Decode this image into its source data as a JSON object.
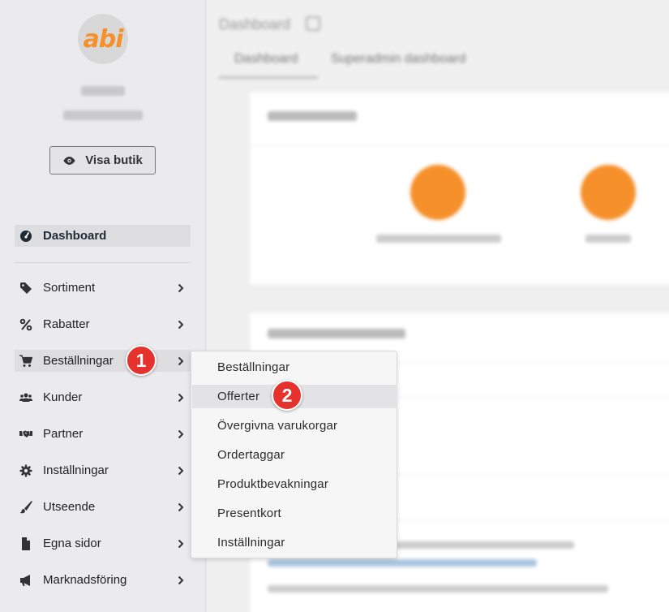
{
  "sidebar": {
    "logo_text": "abi",
    "visa_butik_label": "Visa butik",
    "dashboard_label": "Dashboard",
    "items": [
      {
        "label": "Sortiment",
        "icon": "tag-icon"
      },
      {
        "label": "Rabatter",
        "icon": "percent-icon"
      },
      {
        "label": "Beställningar",
        "icon": "cart-icon"
      },
      {
        "label": "Kunder",
        "icon": "users-icon"
      },
      {
        "label": "Partner",
        "icon": "handshake-icon"
      },
      {
        "label": "Inställningar",
        "icon": "gear-icon"
      },
      {
        "label": "Utseende",
        "icon": "brush-icon"
      },
      {
        "label": "Egna sidor",
        "icon": "file-icon"
      },
      {
        "label": "Marknadsföring",
        "icon": "megaphone-icon"
      }
    ]
  },
  "dropdown": {
    "items": [
      "Beställningar",
      "Offerter",
      "Övergivna varukorgar",
      "Ordertaggar",
      "Produktbevakningar",
      "Presentkort",
      "Inställningar"
    ]
  },
  "badges": {
    "first": "1",
    "second": "2"
  },
  "main": {
    "page_title": "Dashboard",
    "tabs": [
      "Dashboard",
      "Superadmin dashboard"
    ]
  },
  "colors": {
    "accent": "#f6902b",
    "badge": "#e5322d"
  }
}
